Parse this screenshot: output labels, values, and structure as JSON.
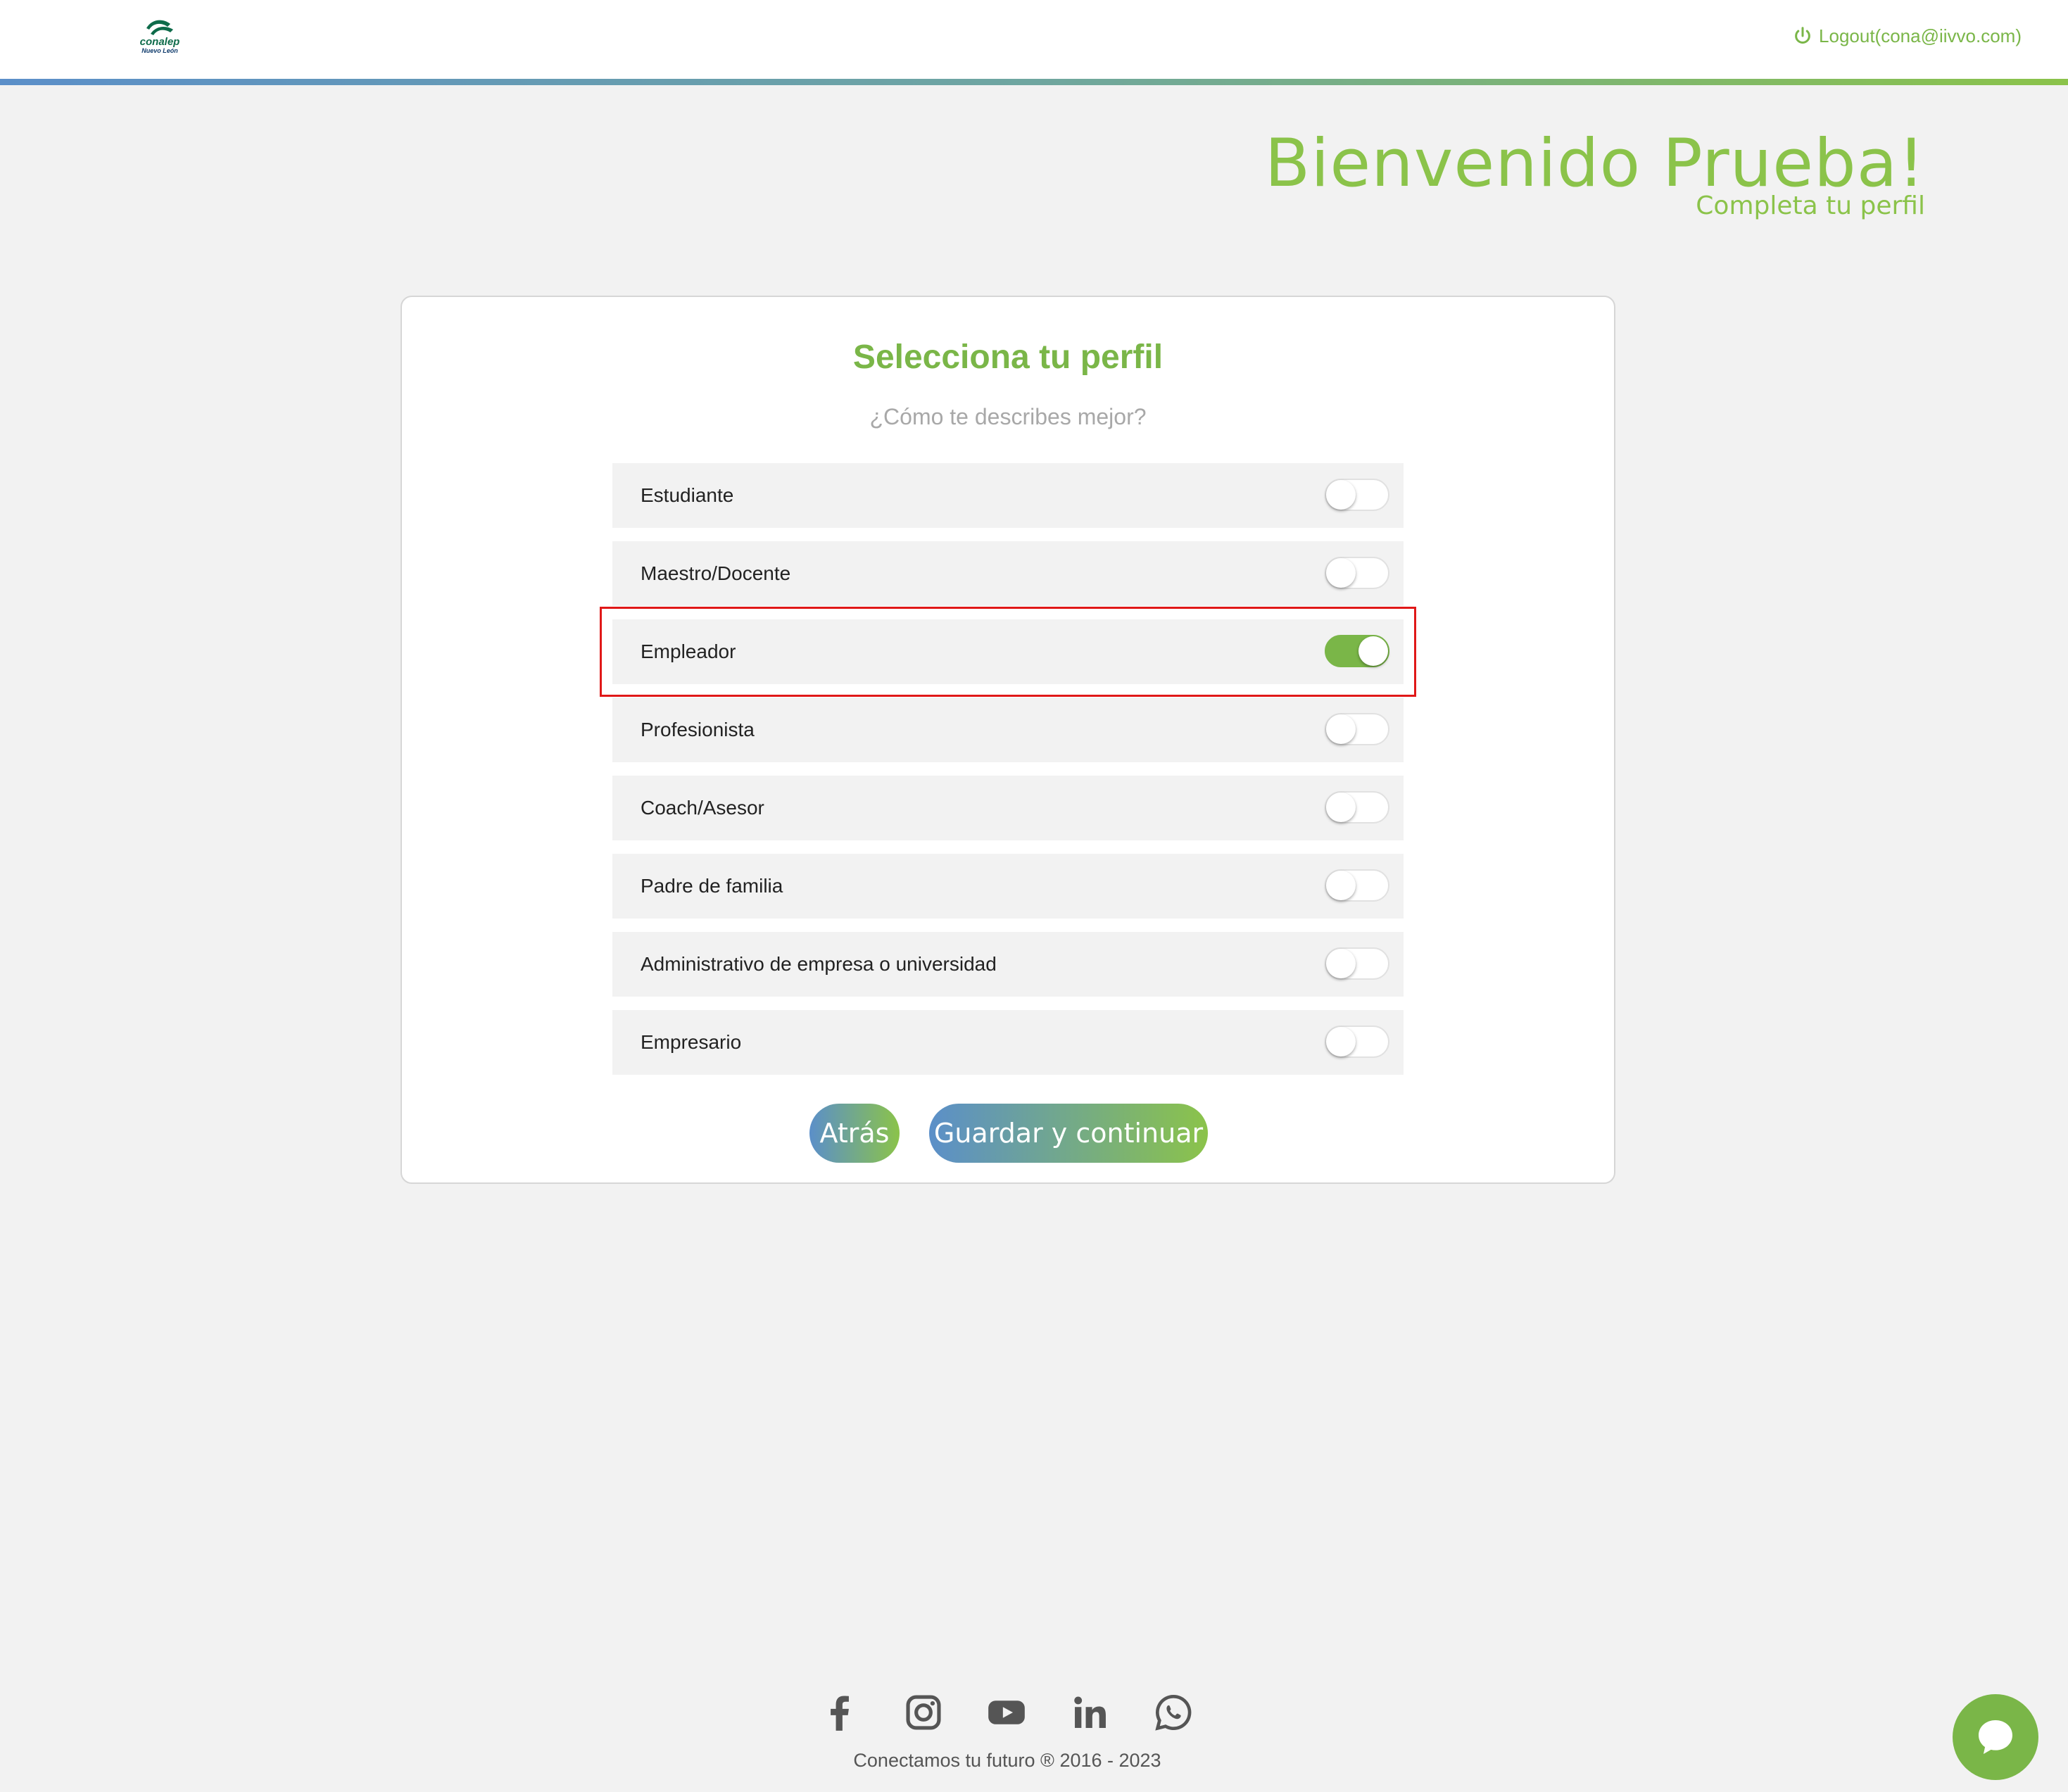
{
  "header": {
    "logo_brand": "conalep",
    "logo_sub": "Nuevo León",
    "logout_label": "Logout(cona@iivvo.com)"
  },
  "welcome": {
    "title": "Bienvenido Prueba!",
    "subtitle": "Completa tu perfil"
  },
  "card": {
    "title": "Selecciona tu perfil",
    "question": "¿Cómo te describes mejor?",
    "options": [
      {
        "label": "Estudiante",
        "on": false
      },
      {
        "label": "Maestro/Docente",
        "on": false
      },
      {
        "label": "Empleador",
        "on": true
      },
      {
        "label": "Profesionista",
        "on": false
      },
      {
        "label": "Coach/Asesor",
        "on": false
      },
      {
        "label": "Padre de familia",
        "on": false
      },
      {
        "label": "Administrativo de empresa o universidad",
        "on": false
      },
      {
        "label": "Empresario",
        "on": false
      }
    ],
    "back_label": "Atrás",
    "save_label": "Guardar y continuar"
  },
  "footer": {
    "social_icons": [
      "facebook-icon",
      "instagram-icon",
      "youtube-icon",
      "linkedin-icon",
      "whatsapp-icon"
    ],
    "copyright": "Conectamos tu futuro ® 2016 - 2023"
  },
  "colors": {
    "accent_green": "#7ab648",
    "gradient_blue": "#5b8fc9",
    "highlight_red": "#e01818"
  }
}
